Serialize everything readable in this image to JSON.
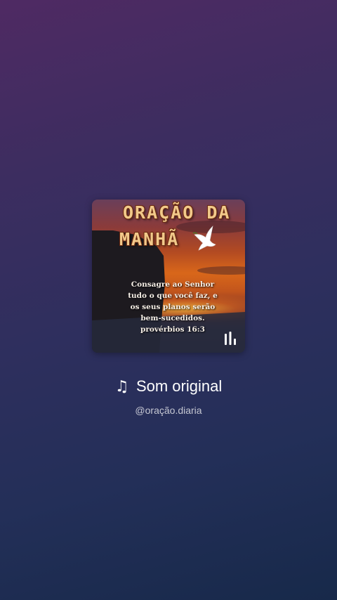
{
  "cover": {
    "title_line1": "ORAÇÃO DA",
    "title_line2": "MANHÃ",
    "verse_lines": [
      "Consagre ao Senhor",
      "tudo o que você faz, e",
      "os seus planos serão",
      "bem-sucedidos.",
      "provérbios 16:3"
    ],
    "icons": [
      "dove-icon",
      "audio-bars-icon"
    ]
  },
  "sound": {
    "note_icon": "♫",
    "title": "Som original",
    "author": "@oração.diaria"
  },
  "colors": {
    "background_top": "#4f2a63",
    "background_bottom": "#17294a",
    "title_gold": "#f1c98a",
    "text_white": "#ffffff"
  }
}
